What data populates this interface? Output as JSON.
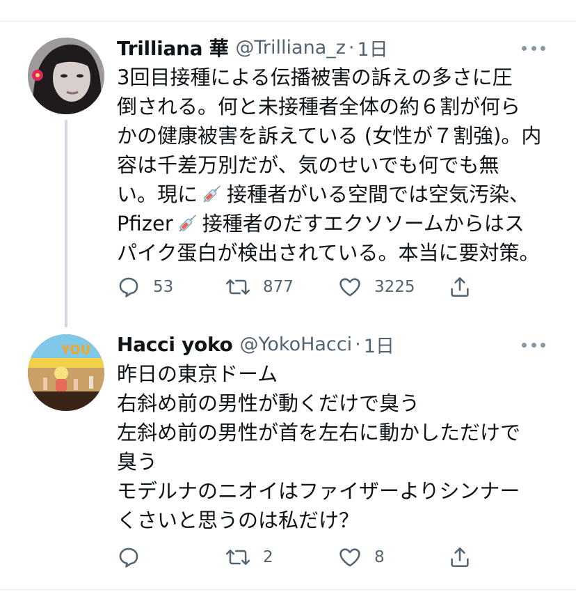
{
  "tweets": [
    {
      "name": "Trilliana 華",
      "handle": "@Trilliana_z",
      "separator": "·",
      "time": "1日",
      "avatar_icon": "profile-photo-woman",
      "text_lines": [
        "3回目接種による伝播被害の訴えの多さに圧",
        "倒される。何と未接種者全体の約６割が何ら",
        "かの健康被害を訴えている (女性が７割強)。内",
        "容は千差万別だが、気のせいでも何でも無",
        [
          "い。現に",
          "syringe",
          "接種者がいる空間では空気汚染、"
        ],
        [
          "Pfizer",
          "syringe",
          "接種者のだすエクソソームからはス"
        ],
        "パイク蛋白が検出されている。本当に要対策。"
      ],
      "replies": "53",
      "retweets": "877",
      "likes": "3225"
    },
    {
      "name": "Hacci yoko",
      "handle": "@YokoHacci",
      "separator": "·",
      "time": "1日",
      "avatar_icon": "profile-photo-stage-mascot",
      "text_lines": [
        "昨日の東京ドーム",
        "右斜め前の男性が動くだけで臭う",
        "左斜め前の男性が首を左右に動かしただけで",
        "臭う",
        "モデルナのニオイはファイザーよりシンナー",
        "くさいと思うのは私だけ？"
      ],
      "replies": "",
      "retweets": "2",
      "likes": "8"
    }
  ],
  "icons": {
    "reply": "reply-icon",
    "retweet": "retweet-icon",
    "like": "heart-icon",
    "share": "share-icon",
    "more": "more-icon",
    "inline_emoji": "syringe-emoji"
  },
  "colors": {
    "text": "#0f1419",
    "secondary": "#536471",
    "icon": "#536471",
    "divider": "#e6ecf0",
    "thread_line": "#cfd9de"
  }
}
